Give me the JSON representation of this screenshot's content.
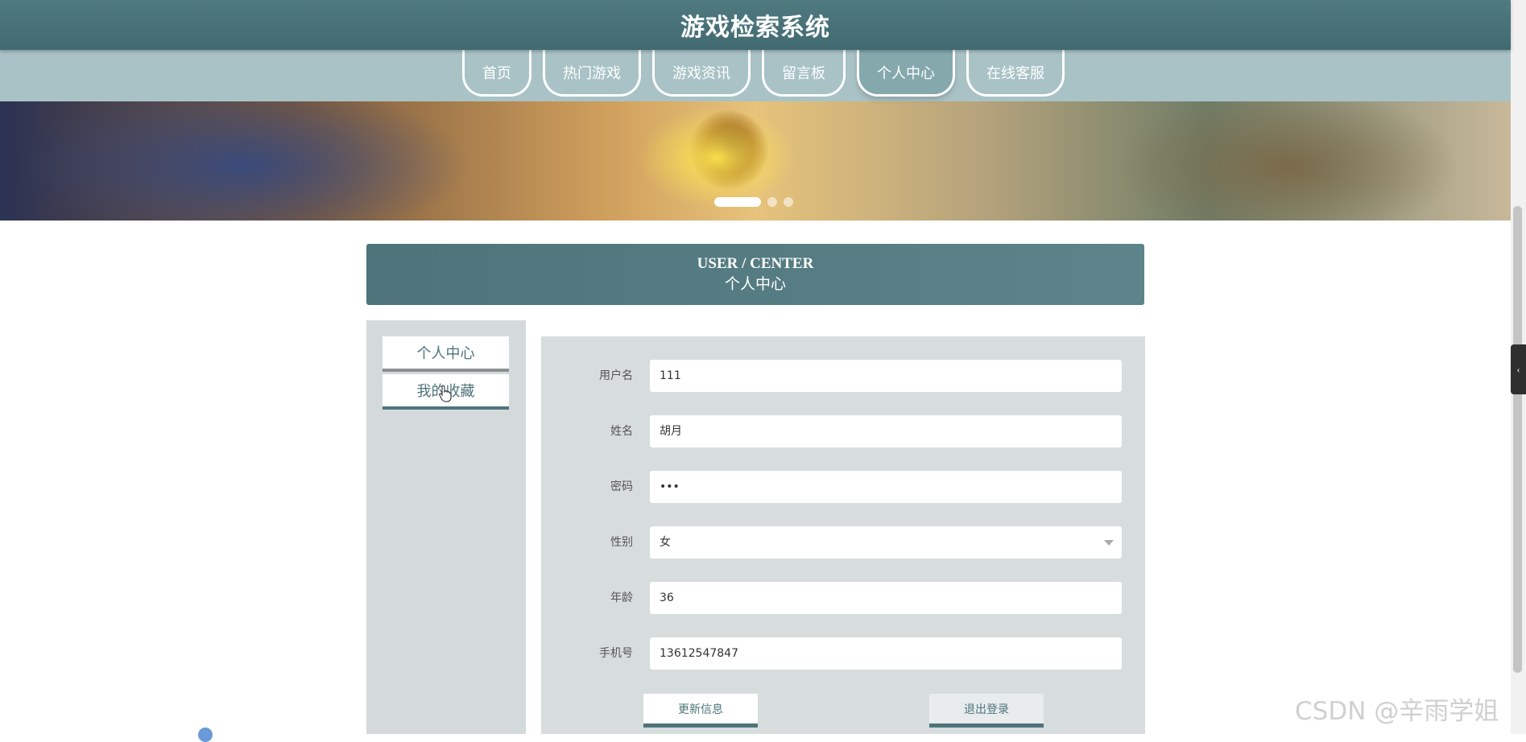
{
  "header": {
    "title": "游戏检索系统"
  },
  "nav": {
    "items": [
      {
        "label": "首页",
        "active": false
      },
      {
        "label": "热门游戏",
        "active": false
      },
      {
        "label": "游戏资讯",
        "active": false
      },
      {
        "label": "留言板",
        "active": false
      },
      {
        "label": "个人中心",
        "active": true
      },
      {
        "label": "在线客服",
        "active": false
      }
    ]
  },
  "banner": {
    "active_slide": 1,
    "slide_count": 3
  },
  "section": {
    "title_en": "USER / CENTER",
    "title_cn": "个人中心"
  },
  "sidebar": {
    "items": [
      {
        "label": "个人中心"
      },
      {
        "label": "我的收藏"
      }
    ]
  },
  "form": {
    "fields": [
      {
        "label": "用户名",
        "value": "111"
      },
      {
        "label": "姓名",
        "value": "胡月"
      },
      {
        "label": "密码",
        "value": "•••"
      },
      {
        "label": "性别",
        "value": "女"
      },
      {
        "label": "年龄",
        "value": "36"
      },
      {
        "label": "手机号",
        "value": "13612547847"
      }
    ],
    "update_label": "更新信息",
    "logout_label": "退出登录"
  },
  "watermark": "CSDN @辛雨学姐",
  "colors": {
    "header": "#4f7a80",
    "nav": "#a9c2c6",
    "accent": "#4d747a",
    "panel": "#d7dcdc"
  }
}
